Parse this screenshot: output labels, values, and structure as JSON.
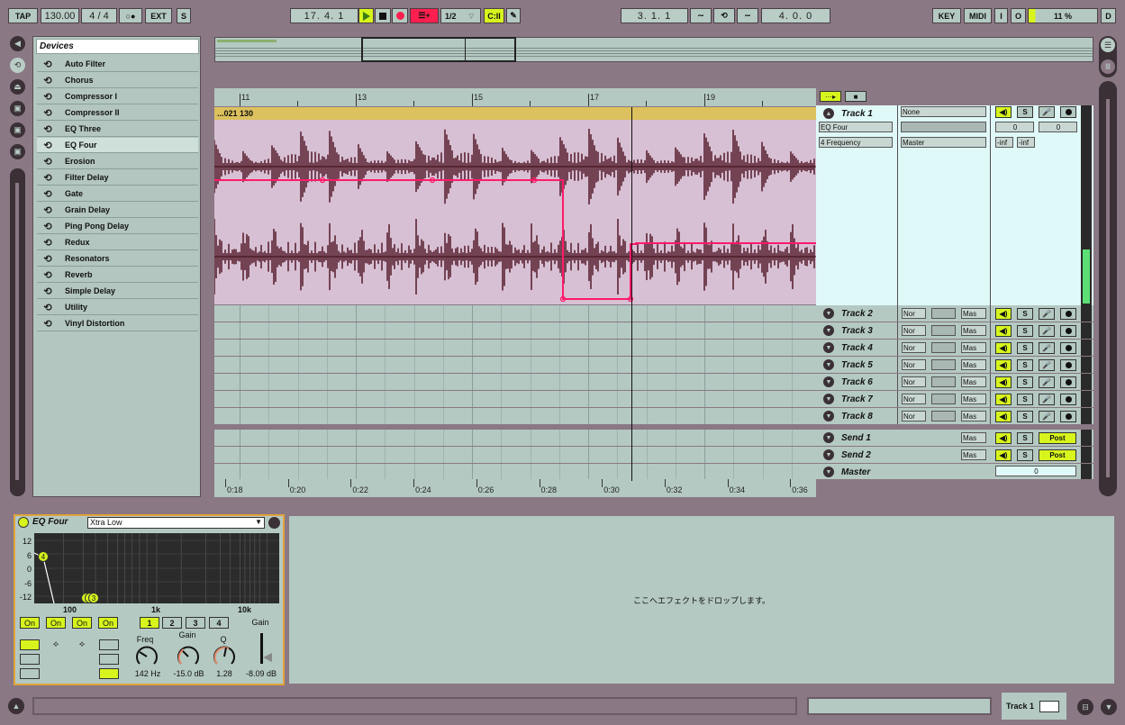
{
  "transport": {
    "tap": "TAP",
    "tempo": "130.00",
    "signature": "4 / 4",
    "metronome": "○●",
    "ext": "EXT",
    "s": "S",
    "position": "17. 4. 1",
    "quantize": "1/2",
    "loop_start": "3. 1. 1",
    "loop_length": "4. 0. 0",
    "key": "KEY",
    "midi": "MIDI",
    "in": "I",
    "out": "O",
    "cpu": "11 %",
    "d": "D"
  },
  "browser": {
    "title": "Devices",
    "items": [
      "Auto Filter",
      "Chorus",
      "Compressor I",
      "Compressor II",
      "EQ Three",
      "EQ Four",
      "Erosion",
      "Filter Delay",
      "Gate",
      "Grain Delay",
      "Ping Pong Delay",
      "Redux",
      "Resonators",
      "Reverb",
      "Simple Delay",
      "Utility",
      "Vinyl Distortion"
    ],
    "selected": "EQ Four"
  },
  "arrangement": {
    "bar_labels": [
      "11",
      "13",
      "15",
      "17",
      "19"
    ],
    "time_labels": [
      "0:18",
      "0:20",
      "0:22",
      "0:24",
      "0:26",
      "0:28",
      "0:30",
      "0:32",
      "0:34",
      "0:36"
    ],
    "clip_name": "...021 130",
    "track1": {
      "name": "Track 1",
      "input": "None",
      "device": "EQ Four",
      "param": "4 Frequency",
      "output": "Master",
      "vol": "0",
      "pan": "0",
      "peak_l": "-inf",
      "peak_r": "-inf",
      "s": "S"
    },
    "tracks": [
      {
        "name": "Track 2",
        "input": "Nor",
        "output": "Mas"
      },
      {
        "name": "Track 3",
        "input": "Nor",
        "output": "Mas"
      },
      {
        "name": "Track 4",
        "input": "Nor",
        "output": "Mas"
      },
      {
        "name": "Track 5",
        "input": "Nor",
        "output": "Mas"
      },
      {
        "name": "Track 6",
        "input": "Nor",
        "output": "Mas"
      },
      {
        "name": "Track 7",
        "input": "Nor",
        "output": "Mas"
      },
      {
        "name": "Track 8",
        "input": "Nor",
        "output": "Mas"
      }
    ],
    "sends": [
      {
        "name": "Send 1",
        "output": "Mas",
        "mode": "Post"
      },
      {
        "name": "Send 2",
        "output": "Mas",
        "mode": "Post"
      }
    ],
    "master": {
      "name": "Master",
      "value": "0"
    }
  },
  "device": {
    "name": "EQ Four",
    "preset": "Xtra Low",
    "db_labels": [
      "12",
      "6",
      "0",
      "-6",
      "-12"
    ],
    "freq_labels": [
      "100",
      "1k",
      "10k"
    ],
    "on_labels": [
      "On",
      "On",
      "On",
      "On"
    ],
    "band_labels": [
      "1",
      "2",
      "3",
      "4"
    ],
    "gain_title": "Gain",
    "freq_label": "Freq",
    "freq_value": "142 Hz",
    "gain_label": "Gain",
    "gain_value": "-15.0 dB",
    "q_label": "Q",
    "q_value": "1.28",
    "out_gain_value": "-8.09 dB",
    "dot_label_1": "4",
    "dot_label_2": "1",
    "dot_label_3": "2",
    "dot_label_4": "3",
    "drop_text": "ここへエフェクトをドロップします。"
  },
  "status": {
    "track": "Track 1"
  },
  "colors": {
    "accent": "#d7f51d",
    "record": "#ff1f4f",
    "automation": "#ff1a6a",
    "clip_bg": "#d8c0d4",
    "lane": "#b4c9c2"
  }
}
